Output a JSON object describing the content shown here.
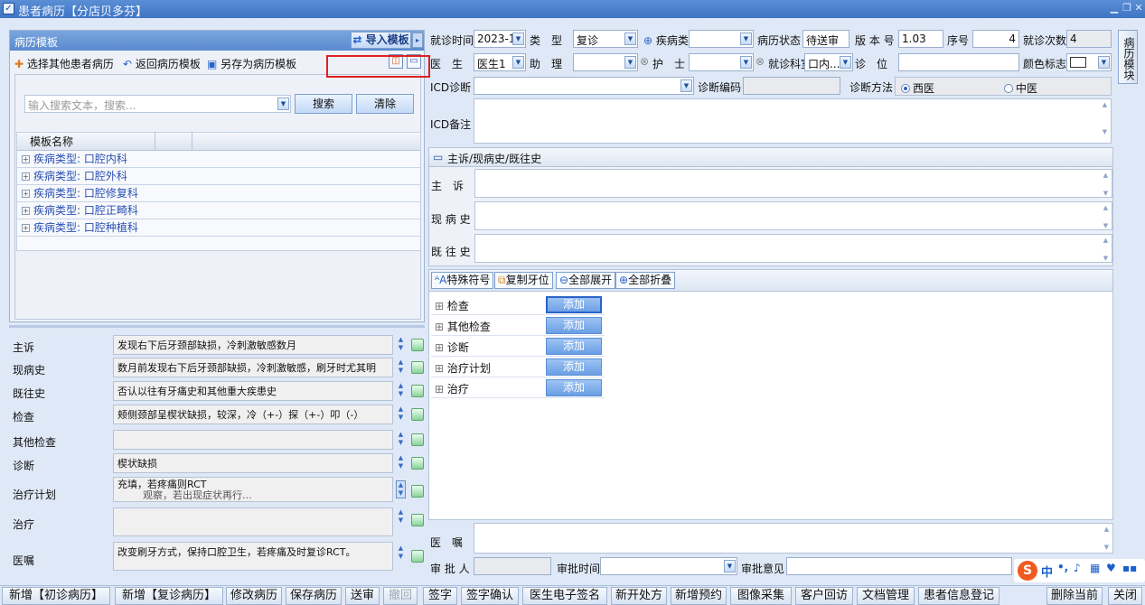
{
  "window": {
    "title": "患者病历【分店贝多芬】"
  },
  "left": {
    "panel_title": "病历模板",
    "import_btn": "导入模板",
    "toolbar": {
      "select_other": "选择其他患者病历",
      "return_template": "返回病历模板",
      "save_as_template": "另存为病历模板"
    },
    "search": {
      "placeholder": "输入搜索文本，搜索...",
      "search_btn": "搜索",
      "clear_btn": "清除"
    },
    "tree": {
      "column": "模板名称",
      "rows": [
        "疾病类型: 口腔内科",
        "疾病类型: 口腔外科",
        "疾病类型: 口腔修复科",
        "疾病类型: 口腔正畸科",
        "疾病类型: 口腔种植科"
      ]
    },
    "fields": [
      {
        "label": "主诉",
        "value": "发现右下后牙颈部缺损，冷刺激敏感数月"
      },
      {
        "label": "现病史",
        "value": "数月前发现右下后牙颈部缺损，冷刺激敏感，刷牙时尤其明"
      },
      {
        "label": "既往史",
        "value": "否认以往有牙痛史和其他重大疾患史"
      },
      {
        "label": "检查",
        "value": "颊侧颈部呈楔状缺损，较深，冷（+-）探（+-）叩（-）"
      },
      {
        "label": "其他检查",
        "value": ""
      },
      {
        "label": "诊断",
        "value": "楔状缺损"
      },
      {
        "label": "治疗计划",
        "value": "充填，若疼痛则RCT",
        "value2": "观察，若出现症状再行..."
      },
      {
        "label": "治疗",
        "value": ""
      },
      {
        "label": "医嘱",
        "value": "改变刷牙方式，保持口腔卫生，若疼痛及时复诊RCT。"
      }
    ]
  },
  "right": {
    "row1": {
      "visit_time_label": "就诊时间",
      "visit_time": "2023-1",
      "type_label": "类　型",
      "type": "复诊",
      "disease_type_label": "疾病类型",
      "disease_type": "",
      "status_label": "病历状态",
      "status": "待送审",
      "version_label": "版 本 号",
      "version": "1.03",
      "seq_label": "序号",
      "seq": "4",
      "visits_label": "就诊次数",
      "visits": "4"
    },
    "row2": {
      "doctor_label": "医　生",
      "doctor": "医生1",
      "assistant_label": "助　理",
      "assistant": "",
      "nurse_label": "护　士",
      "nurse": "",
      "dept_label": "就诊科室",
      "dept": "口内...",
      "position_label": "诊　位",
      "position": "",
      "color_label": "颜色标志"
    },
    "icd": {
      "label": "ICD诊断",
      "code_label": "诊断编码",
      "method_label": "诊断方法",
      "method_options": [
        "西医",
        "中医"
      ],
      "note_label": "ICD备注"
    },
    "history": {
      "section": "主诉/现病史/既往史",
      "chief": "主　诉",
      "present": "现 病 史",
      "past": "既 往 史"
    },
    "exam_toolbar": {
      "special": "特殊符号",
      "copy_tooth": "复制牙位",
      "expand_all": "全部展开",
      "collapse_all": "全部折叠"
    },
    "exam_rows": [
      "检查",
      "其他检查",
      "诊断",
      "治疗计划",
      "治疗"
    ],
    "add_label": "添加",
    "advice_label": "医　嘱",
    "approve": {
      "approver": "审 批 人",
      "time": "审批时间",
      "opinion": "审批意见"
    },
    "side_tab": "病历模块"
  },
  "ime": {
    "lang": "中"
  },
  "bottom_buttons": [
    "新增【初诊病历】",
    "新增【复诊病历】",
    "修改病历",
    "保存病历",
    "送审",
    "撤回",
    "签字",
    "签字确认",
    "医生电子签名",
    "新开处方",
    "新增预约",
    "图像采集",
    "客户回访",
    "文档管理",
    "患者信息登记",
    "删除当前",
    "关闭"
  ],
  "colors": {
    "accent": "#3e74c4",
    "link": "#2a4fb3",
    "highlight_box": "#e02020"
  }
}
